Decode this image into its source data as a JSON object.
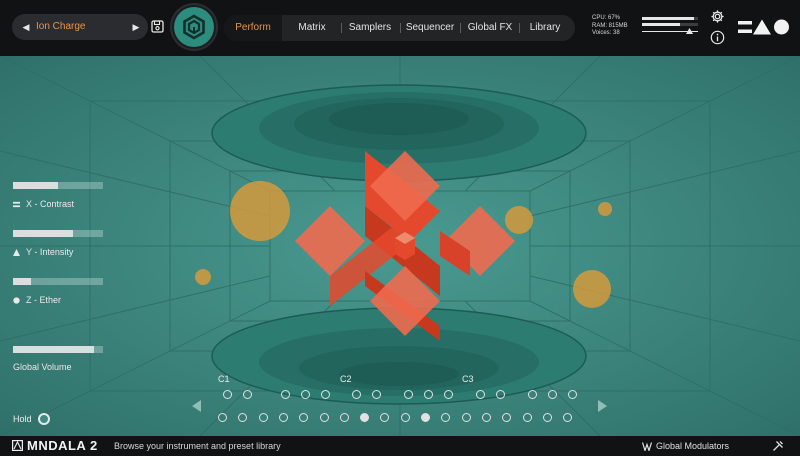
{
  "preset": {
    "name": "Ion Charge",
    "prev_icon": "triangle-left-icon",
    "next_icon": "triangle-right-icon"
  },
  "tabs": [
    "Perform",
    "Matrix",
    "Samplers",
    "Sequencer",
    "Global FX",
    "Library"
  ],
  "stats": {
    "cpu": "CPU: 67%",
    "ram": "RAM: 815MB",
    "voices": "Voices: 38"
  },
  "meters": {
    "volume": 0.92,
    "output": 0.68,
    "slider_position": 0.85
  },
  "controls": [
    {
      "label": "X - Contrast",
      "icon": "equals-icon",
      "value": 0.5
    },
    {
      "label": "Y - Intensity",
      "icon": "triangle-icon",
      "value": 0.67
    },
    {
      "label": "Z - Ether",
      "icon": "circle-icon",
      "value": 0.2
    },
    {
      "label": "Global Volume",
      "icon": "",
      "value": 0.9
    }
  ],
  "hold_label": "Hold",
  "keyboard": {
    "octaves": [
      "C1",
      "C2",
      "C3"
    ],
    "lit_keys": [
      7,
      10
    ]
  },
  "footer": {
    "app_title": "MNDALA 2",
    "hint": "Browse your instrument and preset library",
    "global_modulators": "Global Modulators"
  },
  "colors": {
    "accent": "#e3954f",
    "teal": "#3e8b83",
    "shape": "#e5492d",
    "orb": "#d49a3c"
  }
}
